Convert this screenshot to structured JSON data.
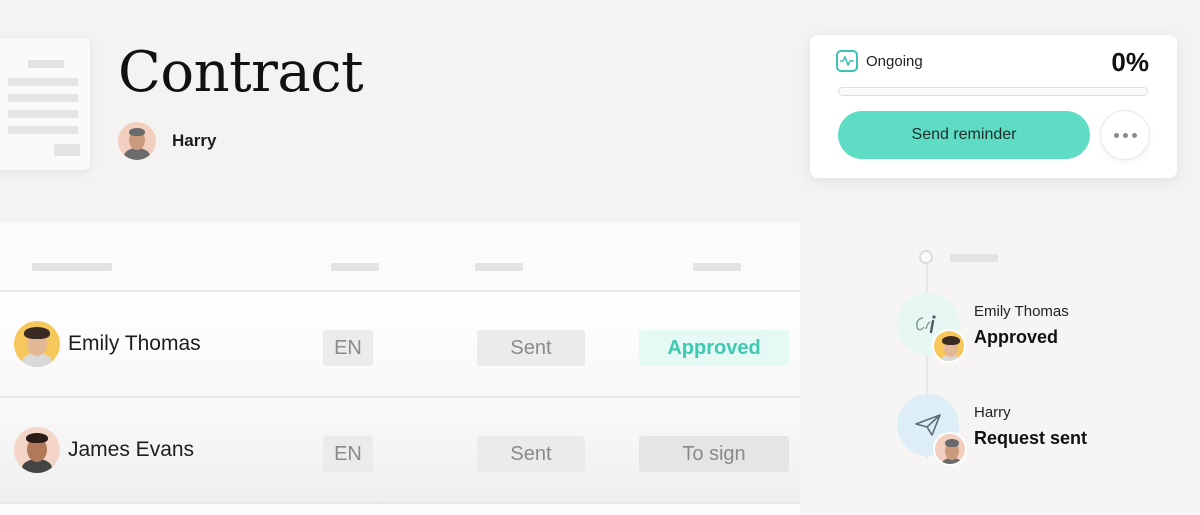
{
  "document": {
    "title": "Contract",
    "owner": "Harry"
  },
  "status_card": {
    "status_label": "Ongoing",
    "status_icon": "pulse-icon",
    "progress_text": "0%",
    "progress_value": 0,
    "send_reminder_label": "Send reminder",
    "more_icon": "more-horizontal-icon",
    "accent_color": "#5fdcc4"
  },
  "signers": [
    {
      "name": "Emily Thomas",
      "language": "EN",
      "delivery": "Sent",
      "status": "Approved"
    },
    {
      "name": "James Evans",
      "language": "EN",
      "delivery": "Sent",
      "status": "To sign"
    }
  ],
  "timeline": [
    {
      "name": "Emily Thomas",
      "action": "Approved",
      "icon": "signature-icon"
    },
    {
      "name": "Harry",
      "action": "Request sent",
      "icon": "paper-plane-icon"
    }
  ]
}
